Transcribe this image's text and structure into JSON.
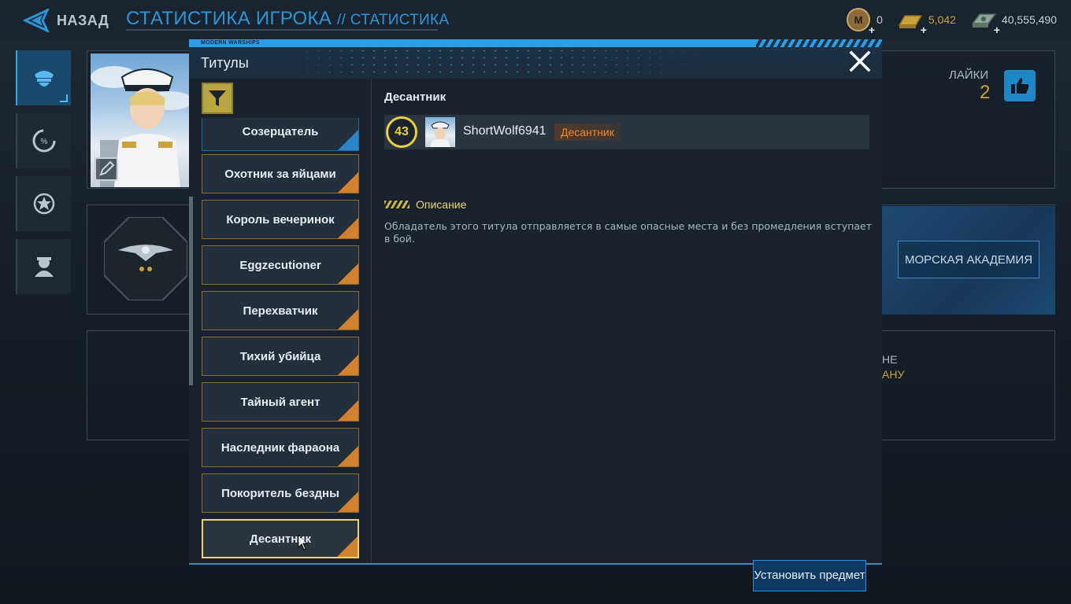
{
  "header": {
    "back_label": "НАЗАД",
    "title": "СТАТИСТИКА ИГРОКА",
    "subtitle": "// СТАТИСТИКА"
  },
  "currencies": [
    {
      "icon": "medal-coin-icon",
      "value": "0"
    },
    {
      "icon": "gold-bar-icon",
      "value": "5,042"
    },
    {
      "icon": "cash-stack-icon",
      "value": "40,555,490"
    }
  ],
  "profile": {
    "likes_label": "ЛАЙКИ",
    "likes_count": "2",
    "academy_button": "МОРСКАЯ АКАДЕМИЯ",
    "peek_line1": "НЕ",
    "peek_line2": "АНУ"
  },
  "modal": {
    "stripe_label": "MODERN WARSHIPS",
    "title": "Титулы",
    "items": [
      {
        "label": "Созерцатель",
        "style": "blue"
      },
      {
        "label": "Охотник за яйцами",
        "style": "orange"
      },
      {
        "label": "Король вечеринок",
        "style": "orange"
      },
      {
        "label": "Eggzecutioner",
        "style": "orange"
      },
      {
        "label": "Перехватчик",
        "style": "orange"
      },
      {
        "label": "Тихий убийца",
        "style": "orange"
      },
      {
        "label": "Тайный агент",
        "style": "orange"
      },
      {
        "label": "Наследник фараона",
        "style": "orange"
      },
      {
        "label": "Покоритель бездны",
        "style": "orange"
      },
      {
        "label": "Десантник",
        "style": "selected"
      }
    ],
    "detail": {
      "name": "Десантник",
      "level": "43",
      "player_name": "ShortWolf6941",
      "title_badge": "Десантник",
      "description_label": "Описание",
      "description": "Обладатель этого титула отправляется в самые опасные места и без промедления вступает в бой.",
      "install_button": "Установить предмет"
    }
  },
  "colors": {
    "accent_blue": "#2a9ee6",
    "gold": "#c9a23a",
    "orange_badge": "#f08a2a",
    "selected_border": "#e8d770"
  }
}
